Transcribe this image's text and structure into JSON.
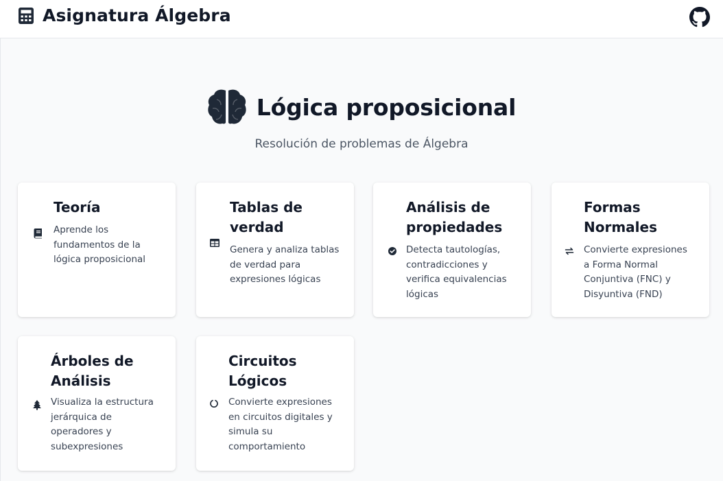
{
  "header": {
    "app_title": "Asignatura Álgebra",
    "logo_icon": "calculator-icon",
    "github_icon": "github-icon"
  },
  "hero": {
    "icon": "brain-icon",
    "title": "Lógica proposicional",
    "subtitle": "Resolución de problemas de Álgebra"
  },
  "cards": [
    {
      "title": "Teoría",
      "description": "Aprende los fundamentos de la lógica proposicional",
      "icon": "book-icon"
    },
    {
      "title": "Tablas de verdad",
      "description": "Genera y analiza tablas de verdad para expresiones lógicas",
      "icon": "table-icon"
    },
    {
      "title": "Análisis de propiedades",
      "description": "Detecta tautologías, contradicciones y verifica equivalencias lógicas",
      "icon": "check-circle-icon"
    },
    {
      "title": "Formas Normales",
      "description": "Convierte expresiones a Forma Normal Conjuntiva (FNC) y Disyuntiva (FND)",
      "icon": "exchange-icon"
    },
    {
      "title": "Árboles de Análisis",
      "description": "Visualiza la estructura jerárquica de operadores y subexpresiones",
      "icon": "tree-icon"
    },
    {
      "title": "Circuitos Lógicos",
      "description": "Convierte expresiones en circuitos digitales y simula su comportamiento",
      "icon": "circle-notch-icon"
    }
  ],
  "colors": {
    "background": "#f9fafb",
    "card": "#ffffff",
    "text": "#111827",
    "muted": "#4b5563",
    "border": "#e5e7eb"
  }
}
